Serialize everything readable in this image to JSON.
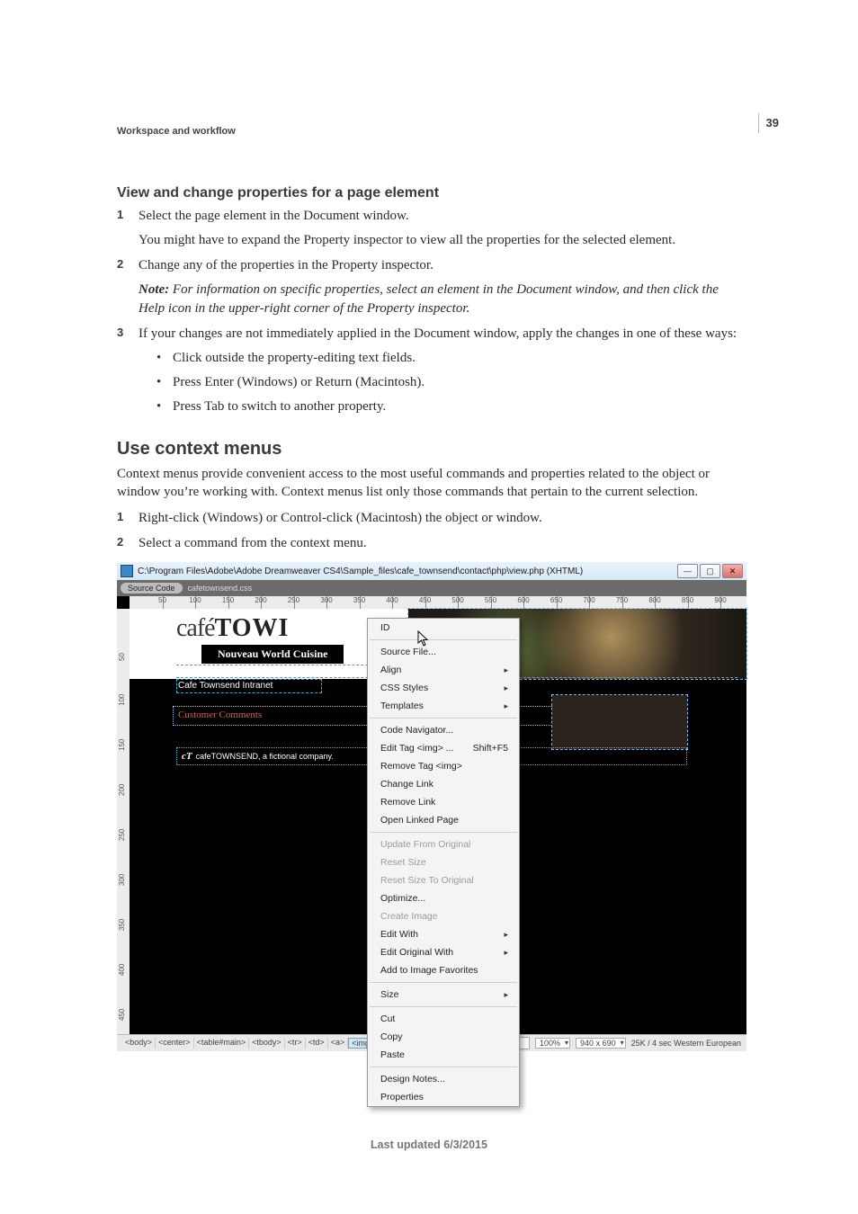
{
  "page": {
    "number": "39",
    "header": "Workspace and workflow",
    "last_updated": "Last updated 6/3/2015"
  },
  "section1": {
    "title": "View and change properties for a page element",
    "steps": [
      {
        "num": "1",
        "text": "Select the page element in the Document window.",
        "sub": "You might have to expand the Property inspector to view all the properties for the selected element."
      },
      {
        "num": "2",
        "text": "Change any of the properties in the Property inspector.",
        "note_label": "Note:",
        "note": " For information on specific properties, select an element in the Document window, and then click the Help icon in the upper-right corner of the Property inspector."
      },
      {
        "num": "3",
        "text": "If your changes are not immediately applied in the Document window, apply the changes in one of these ways:",
        "bullets": [
          "Click outside the property-editing text fields.",
          "Press Enter (Windows) or Return (Macintosh).",
          "Press Tab to switch to another property."
        ]
      }
    ]
  },
  "section2": {
    "title": "Use context menus",
    "intro": "Context menus provide convenient access to the most useful commands and properties related to the object or window you’re working with. Context menus list only those commands that pertain to the current selection.",
    "steps": [
      {
        "num": "1",
        "text": "Right-click (Windows) or Control-click (Macintosh) the object or window."
      },
      {
        "num": "2",
        "text": "Select a command from the context menu."
      }
    ]
  },
  "screenshot": {
    "title": "C:\\Program Files\\Adobe\\Adobe Dreamweaver CS4\\Sample_files\\cafe_townsend\\contact\\php\\view.php (XHTML)",
    "source_button": "Source Code",
    "source_file": "cafetownsend.css",
    "logo_left": "café",
    "logo_right": "TOWI",
    "subtitle": "Nouveau World Cuisine",
    "intranet": "Cafe Townsend Intranet",
    "customer_comments": "Customer Comments",
    "footer_ct": "cT",
    "footer_text": "cafeTOWNSEND, a fictional company.",
    "ruler_h": [
      "50",
      "100",
      "150",
      "200",
      "250",
      "300",
      "350",
      "400",
      "450",
      "500",
      "550",
      "600",
      "650",
      "700",
      "750",
      "800",
      "850",
      "900"
    ],
    "ruler_v": [
      "50",
      "100",
      "150",
      "200",
      "250",
      "300",
      "350",
      "400",
      "450"
    ],
    "context_menu": [
      {
        "label": "ID",
        "sub": false
      },
      {
        "sep": true
      },
      {
        "label": "Source File...",
        "sub": false
      },
      {
        "label": "Align",
        "sub": true
      },
      {
        "label": "CSS Styles",
        "sub": true
      },
      {
        "label": "Templates",
        "sub": true
      },
      {
        "sep": true
      },
      {
        "label": "Code Navigator...",
        "sub": false
      },
      {
        "label": "Edit Tag <img> ...",
        "shortcut": "Shift+F5"
      },
      {
        "label": "Remove Tag <img>",
        "sub": false
      },
      {
        "label": "Change Link",
        "sub": false
      },
      {
        "label": "Remove Link",
        "sub": false
      },
      {
        "label": "Open Linked Page",
        "sub": false
      },
      {
        "sep": true
      },
      {
        "label": "Update From Original",
        "disabled": true
      },
      {
        "label": "Reset Size",
        "disabled": true
      },
      {
        "label": "Reset Size To Original",
        "disabled": true
      },
      {
        "label": "Optimize...",
        "sub": false
      },
      {
        "label": "Create Image",
        "disabled": true
      },
      {
        "label": "Edit With",
        "sub": true
      },
      {
        "label": "Edit Original With",
        "sub": true
      },
      {
        "label": "Add to Image Favorites",
        "sub": false
      },
      {
        "sep": true
      },
      {
        "label": "Size",
        "sub": true
      },
      {
        "sep": true
      },
      {
        "label": "Cut",
        "sub": false
      },
      {
        "label": "Copy",
        "sub": false
      },
      {
        "label": "Paste",
        "sub": false
      },
      {
        "sep": true
      },
      {
        "label": "Design Notes...",
        "sub": false
      },
      {
        "label": "Properties",
        "sub": false
      }
    ],
    "statusbar": {
      "tags": [
        "<body>",
        "<center>",
        "<table#main>",
        "<tbody>",
        "<tr>",
        "<td>",
        "<a>",
        "<img>"
      ],
      "zoom": "100%",
      "dim": "940 x 690",
      "rest": "25K / 4 sec  Western European"
    }
  }
}
